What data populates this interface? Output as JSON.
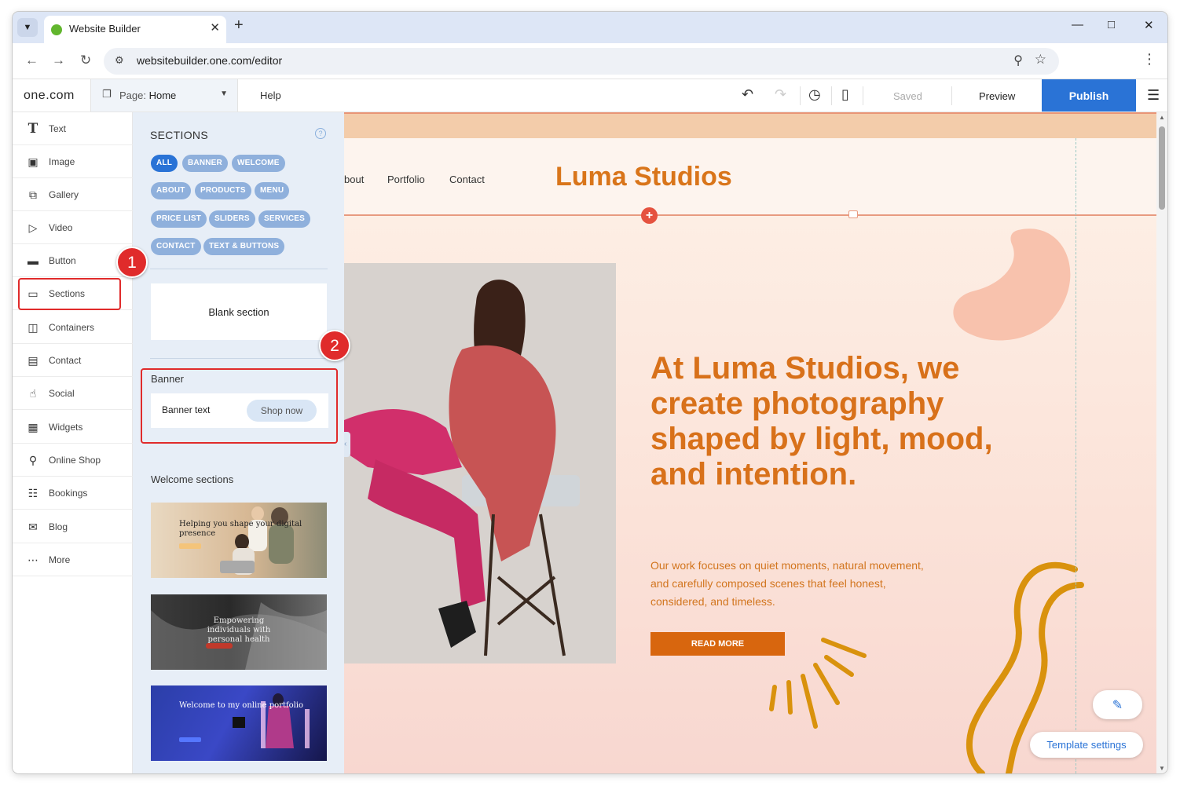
{
  "browser": {
    "tab_title": "Website Builder",
    "url": "websitebuilder.one.com/editor"
  },
  "editor": {
    "logo": "one.com",
    "page_label": "Page:",
    "page_value": "Home",
    "help": "Help",
    "saved": "Saved",
    "preview": "Preview",
    "publish": "Publish"
  },
  "tools": [
    {
      "label": "Text",
      "icon": "text-icon"
    },
    {
      "label": "Image",
      "icon": "image-icon"
    },
    {
      "label": "Gallery",
      "icon": "gallery-icon"
    },
    {
      "label": "Video",
      "icon": "video-icon"
    },
    {
      "label": "Button",
      "icon": "button-icon"
    },
    {
      "label": "Sections",
      "icon": "sections-icon"
    },
    {
      "label": "Containers",
      "icon": "containers-icon"
    },
    {
      "label": "Contact",
      "icon": "contact-icon"
    },
    {
      "label": "Social",
      "icon": "social-icon"
    },
    {
      "label": "Widgets",
      "icon": "widgets-icon"
    },
    {
      "label": "Online Shop",
      "icon": "cart-icon"
    },
    {
      "label": "Bookings",
      "icon": "calendar-icon"
    },
    {
      "label": "Blog",
      "icon": "blog-icon"
    },
    {
      "label": "More",
      "icon": "more-icon"
    }
  ],
  "panel": {
    "heading": "SECTIONS",
    "help_glyph": "?",
    "filters": [
      "ALL",
      "BANNER",
      "WELCOME",
      "ABOUT",
      "PRODUCTS",
      "MENU",
      "PRICE LIST",
      "SLIDERS",
      "SERVICES",
      "CONTACT",
      "TEXT & BUTTONS"
    ],
    "active_filter": "ALL",
    "blank_section": "Blank section",
    "banner_heading": "Banner",
    "banner_text": "Banner text",
    "banner_button": "Shop now",
    "welcome_heading": "Welcome sections",
    "thumbs": [
      {
        "title": "Helping you shape your digital presence"
      },
      {
        "title": "Empowering individuals with personal health"
      },
      {
        "title": "Welcome to my online portfolio"
      }
    ]
  },
  "site": {
    "menu": [
      "bout",
      "Portfolio",
      "Contact"
    ],
    "brand": "Luma Studios",
    "headline": "At Luma Studios, we create photography shaped by light, mood, and intention.",
    "body": "Our work focuses on quiet moments, natural movement, and carefully composed scenes that feel honest, considered, and timeless.",
    "cta": "READ MORE",
    "template_settings": "Template settings"
  },
  "annotations": [
    "1",
    "2"
  ],
  "colors": {
    "accent": "#2a73d6",
    "brand_orange": "#d8711a",
    "annotation_red": "#e02b2b"
  }
}
